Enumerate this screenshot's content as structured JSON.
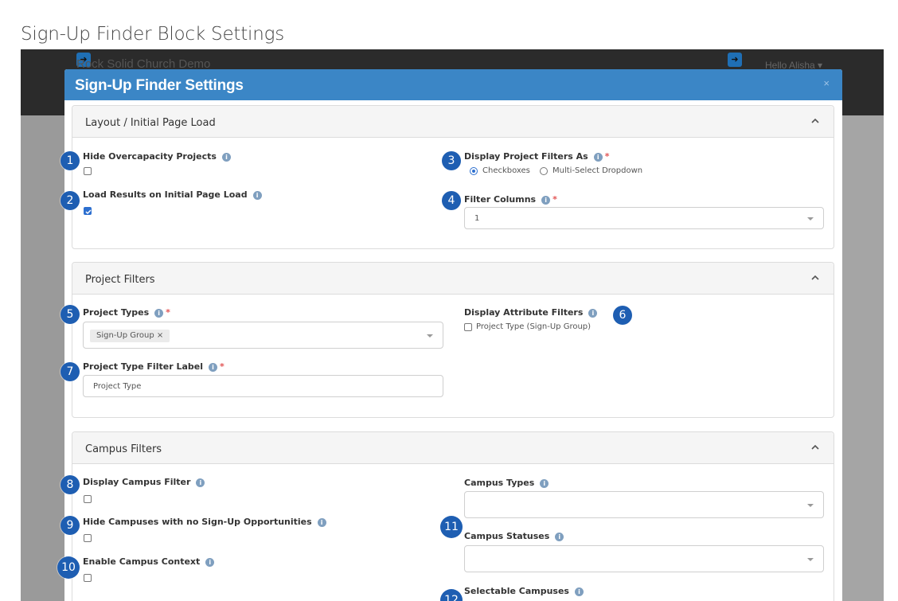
{
  "page_title": "Sign-Up Finder Block Settings",
  "background_app": {
    "brand": "Rock Solid Church Demo",
    "greeting": "Hello Alisha ▾",
    "toggle_icon": "circle-arrow-right-icon"
  },
  "modal": {
    "title": "Sign-Up Finder Settings",
    "close_label": "×"
  },
  "panels": {
    "layout": {
      "title": "Layout / Initial Page Load",
      "hide_overcapacity": {
        "label": "Hide Overcapacity Projects",
        "checked": false
      },
      "load_results": {
        "label": "Load Results on Initial Page Load",
        "checked": true
      },
      "display_filters_as": {
        "label": "Display Project Filters As",
        "required": true,
        "options": [
          "Checkboxes",
          "Multi-Select Dropdown"
        ],
        "selected": "Checkboxes"
      },
      "filter_columns": {
        "label": "Filter Columns",
        "required": true,
        "value": "1"
      }
    },
    "project_filters": {
      "title": "Project Filters",
      "project_types": {
        "label": "Project Types",
        "required": true,
        "tags": [
          "Sign-Up Group ×"
        ]
      },
      "display_attribute_filters": {
        "label": "Display Attribute Filters",
        "option": "Project Type (Sign-Up Group)",
        "checked": false
      },
      "project_type_filter_label": {
        "label": "Project Type Filter Label",
        "required": true,
        "value": "Project Type"
      }
    },
    "campus_filters": {
      "title": "Campus Filters",
      "display_campus_filter": {
        "label": "Display Campus Filter",
        "checked": false
      },
      "hide_campuses": {
        "label": "Hide Campuses with no Sign-Up Opportunities",
        "checked": false
      },
      "enable_campus_context": {
        "label": "Enable Campus Context",
        "checked": false
      },
      "campus_types": {
        "label": "Campus Types",
        "value": ""
      },
      "campus_statuses": {
        "label": "Campus Statuses",
        "value": ""
      },
      "selectable_campuses": {
        "label": "Selectable Campuses"
      }
    }
  },
  "markers": [
    "1",
    "2",
    "3",
    "4",
    "5",
    "6",
    "7",
    "8",
    "9",
    "10",
    "11",
    "12"
  ],
  "info_glyph": "i",
  "required_glyph": "*",
  "colors": {
    "modal_header": "#3b86c6",
    "marker": "#1e5eb2",
    "checkbox_checked": "#2d6fcf",
    "required": "#e25555"
  }
}
